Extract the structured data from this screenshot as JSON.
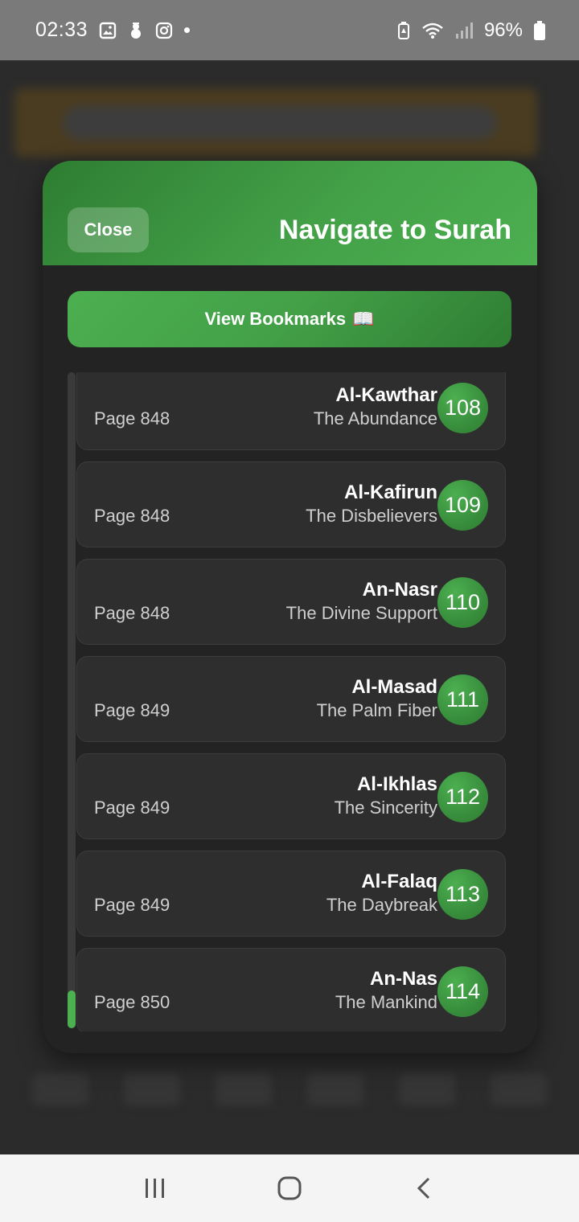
{
  "status_bar": {
    "time": "02:33",
    "battery": "96%",
    "left_icons": [
      "gallery-icon",
      "snowman-icon",
      "instagram-icon",
      "dot-icon"
    ],
    "right_icons": [
      "battery-saver-icon",
      "wifi-icon",
      "signal-icon",
      "battery-icon"
    ]
  },
  "modal": {
    "close_label": "Close",
    "title": "Navigate to Surah",
    "bookmarks_label": "View Bookmarks",
    "bookmarks_emoji": "📖"
  },
  "surahs": [
    {
      "number": "108",
      "name": "Al-Kawthar",
      "meaning": "The Abundance",
      "page": "Page 848"
    },
    {
      "number": "109",
      "name": "Al-Kafirun",
      "meaning": "The Disbelievers",
      "page": "Page 848"
    },
    {
      "number": "110",
      "name": "An-Nasr",
      "meaning": "The Divine Support",
      "page": "Page 848"
    },
    {
      "number": "111",
      "name": "Al-Masad",
      "meaning": "The Palm Fiber",
      "page": "Page 849"
    },
    {
      "number": "112",
      "name": "Al-Ikhlas",
      "meaning": "The Sincerity",
      "page": "Page 849"
    },
    {
      "number": "113",
      "name": "Al-Falaq",
      "meaning": "The Daybreak",
      "page": "Page 849"
    },
    {
      "number": "114",
      "name": "An-Nas",
      "meaning": "The Mankind",
      "page": "Page 850"
    }
  ],
  "colors": {
    "accent": "#4caf50",
    "accent_dark": "#2e7d32",
    "card_bg": "#2e2e2e",
    "modal_bg": "#232323"
  },
  "nav_bar": {
    "icons": [
      "recent-apps-icon",
      "home-icon",
      "back-icon"
    ]
  }
}
